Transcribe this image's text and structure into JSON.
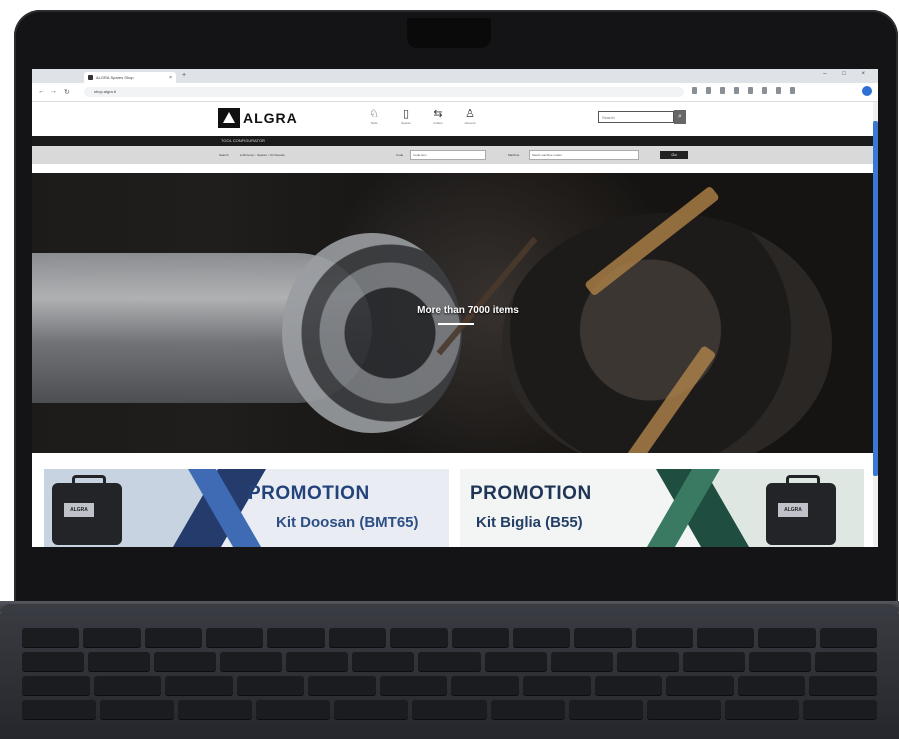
{
  "browser": {
    "tab_title": "ALGRA Spares Shop",
    "tab_close": "×",
    "new_tab": "+",
    "window_controls": "– □ ×",
    "back": "←",
    "forward": "→",
    "reload": "↻",
    "address": "shop.algra.it"
  },
  "site": {
    "logo_text": "ALGRA",
    "nav_items": [
      {
        "icon": "bolt-icon",
        "glyph": "♘",
        "label": "Tools"
      },
      {
        "icon": "doc-icon",
        "glyph": "▯",
        "label": "Spares"
      },
      {
        "icon": "truck-icon",
        "glyph": "⇆",
        "label": "Orders"
      },
      {
        "icon": "user-icon",
        "glyph": "♙",
        "label": "Account"
      }
    ],
    "search_placeholder": "Search",
    "search_button": "⌕",
    "dark_bar_text": "TOOL CONFIGURATOR",
    "filters": {
      "label_type": "Search",
      "options": "● All items ○ Spares ○ Kit Doosan",
      "label_code": "Code",
      "code_value": "Code item",
      "label_machine": "Machine",
      "machine_value": "Select machine model",
      "button": "Go"
    }
  },
  "hero": {
    "title": "More than 7000 items"
  },
  "promotions": [
    {
      "title": "PROMOTION",
      "subtitle": "Kit Doosan (BMT65)",
      "case_logo": "ALGRA"
    },
    {
      "title": "PROMOTION",
      "subtitle": "Kit Biglia (B55)",
      "case_logo": "ALGRA"
    }
  ],
  "colors": {
    "promo_left_bg": "#c8d3e1",
    "promo_right_bg": "#dfe7e3",
    "promo_blue": "#23427a",
    "promo_green": "#1f4d3f"
  }
}
